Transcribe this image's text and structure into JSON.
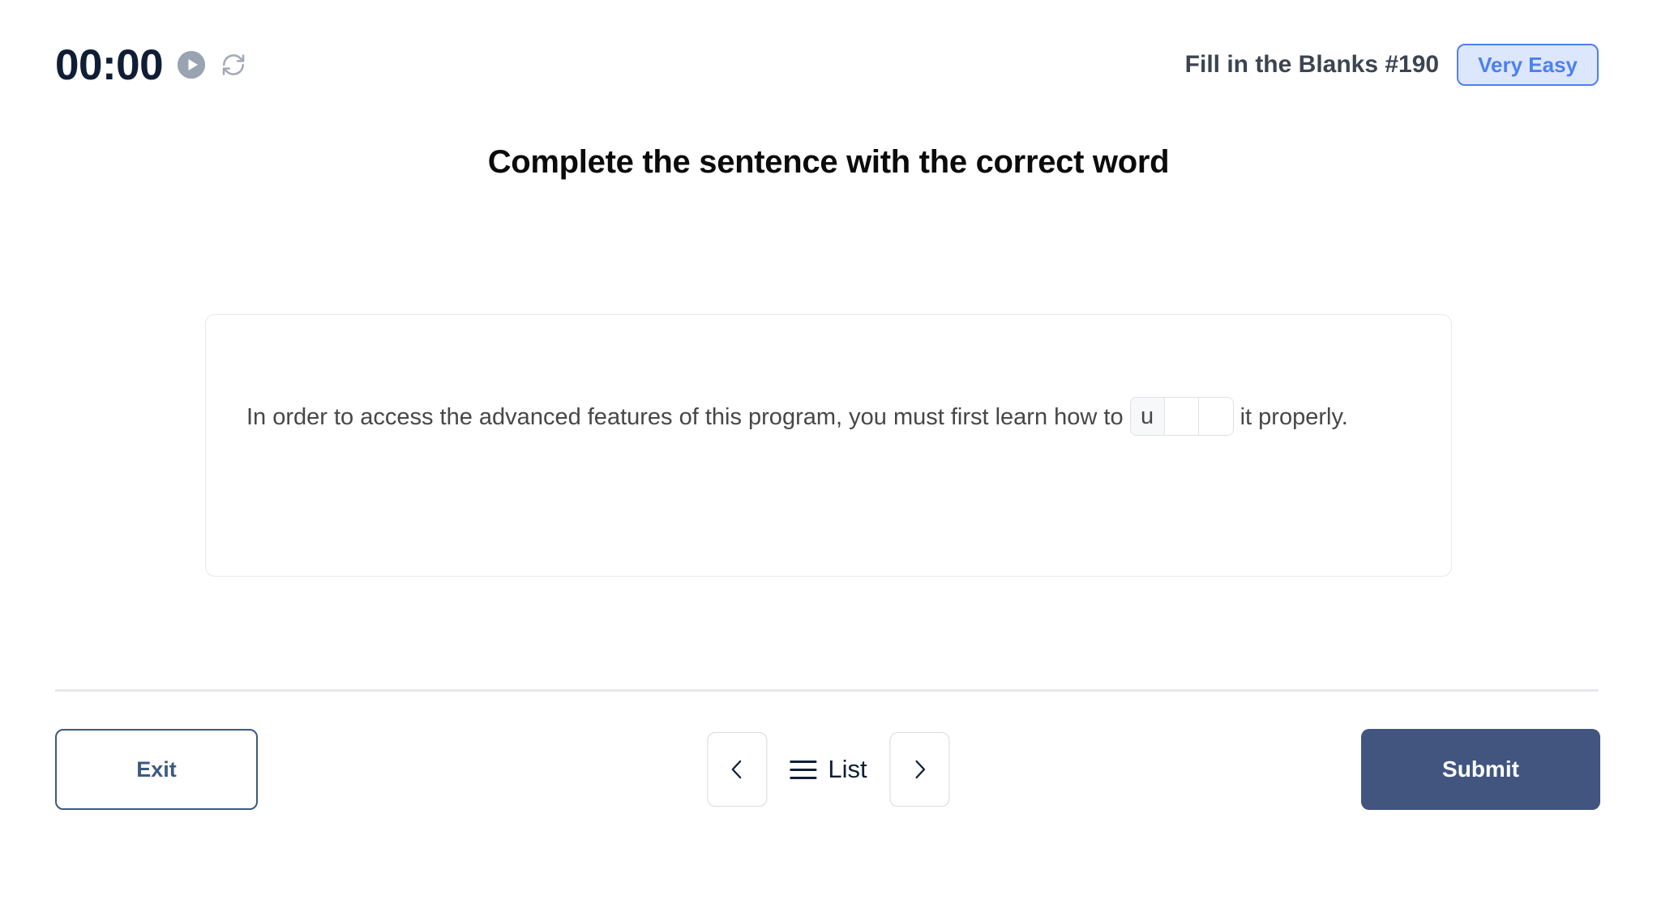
{
  "header": {
    "timer": "00:00",
    "play_icon": "play-icon",
    "reset_icon": "refresh-icon",
    "quiz_label": "Fill in the Blanks #190",
    "difficulty": "Very Easy",
    "difficulty_bg": "#dce7fd",
    "difficulty_border": "#4d80f0",
    "difficulty_text_color": "#4d80f0"
  },
  "page_title": "Complete the sentence with the correct word",
  "question": {
    "sentence_before": "In order to access the advanced features of this program, you must first learn how to",
    "sentence_after": "it properly.",
    "blank_cells": [
      "u",
      "",
      ""
    ],
    "blank_length": 3
  },
  "footer": {
    "exit_label": "Exit",
    "prev_icon": "chevron-left-icon",
    "list_icon": "hamburger-icon",
    "list_label": "List",
    "next_icon": "chevron-right-icon",
    "submit_label": "Submit",
    "submit_color": "#41557f",
    "exit_border_color": "#3d5a80"
  }
}
